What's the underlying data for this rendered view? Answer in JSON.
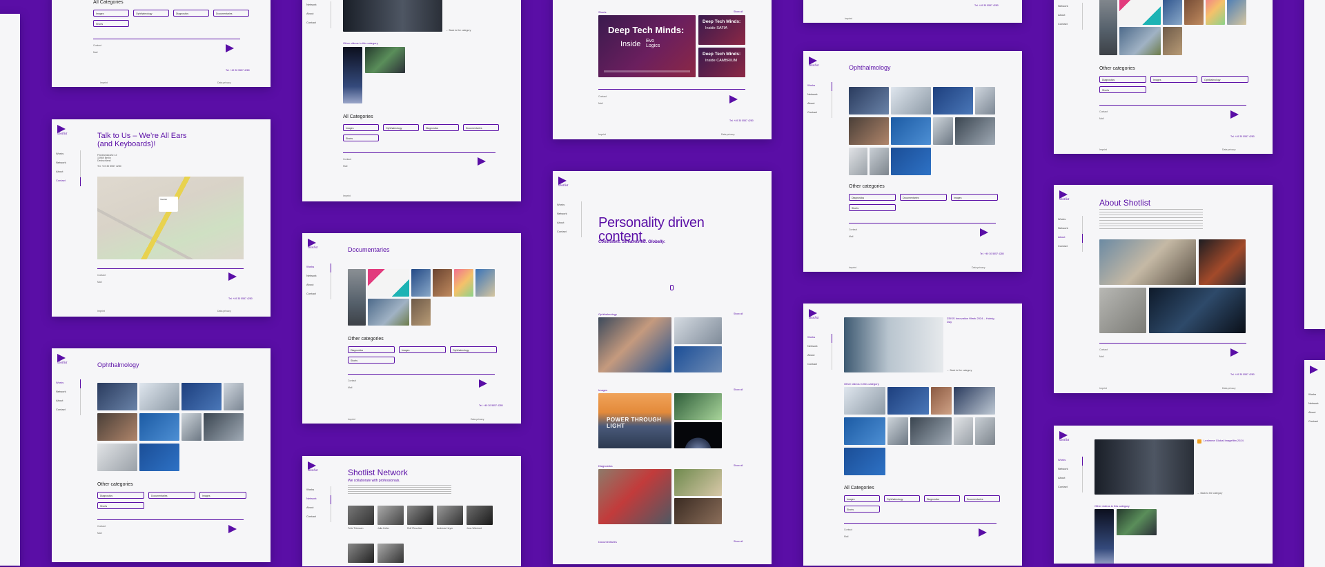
{
  "nav": [
    "Works",
    "Network",
    "About",
    "Contact"
  ],
  "footer": {
    "contact": "Contact",
    "email": "Mail",
    "address": "Friedrichstraße 12\n10969 Berlin\nDeutschland",
    "phone": "Tel. +49 30 5557 4280",
    "legal": "Imprint",
    "privacy": "Data privacy"
  },
  "p1": {
    "all_categories": "All Categories",
    "tags": [
      "Images",
      "Ophthalmology",
      "Diagnostics",
      "Documentaries",
      "Shorts"
    ]
  },
  "p2": {
    "title": "Talk to Us – We’re All Ears (and Keyboards)!",
    "map_label": "Shotlist"
  },
  "p3": {
    "title": "Ophthalmology",
    "other": "Other categories",
    "tags": [
      "Diagnostics",
      "Documentaries",
      "Images",
      "Shorts"
    ]
  },
  "p4": {
    "more": "Other videos in this category",
    "all_categories": "All Categories",
    "tags": [
      "Images",
      "Ophthalmology",
      "Diagnostics",
      "Documentaries",
      "Shorts"
    ]
  },
  "p5": {
    "title": "Documentaries",
    "other": "Other categories",
    "tags": [
      "Diagnostics",
      "Images",
      "Ophthalmology",
      "Shorts"
    ]
  },
  "p6": {
    "title": "Shotlist Network",
    "subtitle": "We collaborate with professionals.",
    "people": [
      "Felix Thiessen",
      "Julia Keller",
      "Rolf Pluschke",
      "Andreas Heyer",
      "Jens Weichert"
    ]
  },
  "p7": {
    "section": "Shorts",
    "deep1": "Deep Tech Minds:",
    "inside1": "Inside",
    "evo": "Evo Logics",
    "deep2": "Deep Tech Minds:",
    "inside2": "Inside SAFIA",
    "deep3": "Deep Tech Minds:",
    "inside3": "Inside CAMBRIUM",
    "show_all": "Show all"
  },
  "p8": {
    "headline": "Personality driven content.",
    "tagline": "Consistent. Streamlined. Globally.",
    "cat1": "Ophthalmology",
    "cat2": "Images",
    "cat3": "Diagnostics",
    "cat4": "Documentaries",
    "show_all": "Show all",
    "power": "POWER THROUGH LIGHT"
  },
  "p9": {
    "title": "Ophthalmology",
    "other": "Other categories",
    "tags": [
      "Diagnostics",
      "Documentaries",
      "Images",
      "Shorts"
    ]
  },
  "p10": {
    "video_title": "ZEISS Innovation Week 2024 – Hubrig Day",
    "more": "Other videos in this category",
    "all_categories": "All Categories",
    "tags": [
      "Images",
      "Ophthalmology",
      "Diagnostics",
      "Documentaries",
      "Shorts"
    ]
  },
  "p11": {
    "other": "Other categories",
    "tags": [
      "Diagnostics",
      "Images",
      "Ophthalmology",
      "Shorts"
    ]
  },
  "p12": {
    "title": "About Shotlist"
  },
  "p13": {
    "video_title": "Lexfarme Global Imagefilm 2024",
    "more": "Other videos in this category"
  },
  "colors": {
    "brand": "#5a0ea6",
    "page": "#f6f6f8"
  }
}
